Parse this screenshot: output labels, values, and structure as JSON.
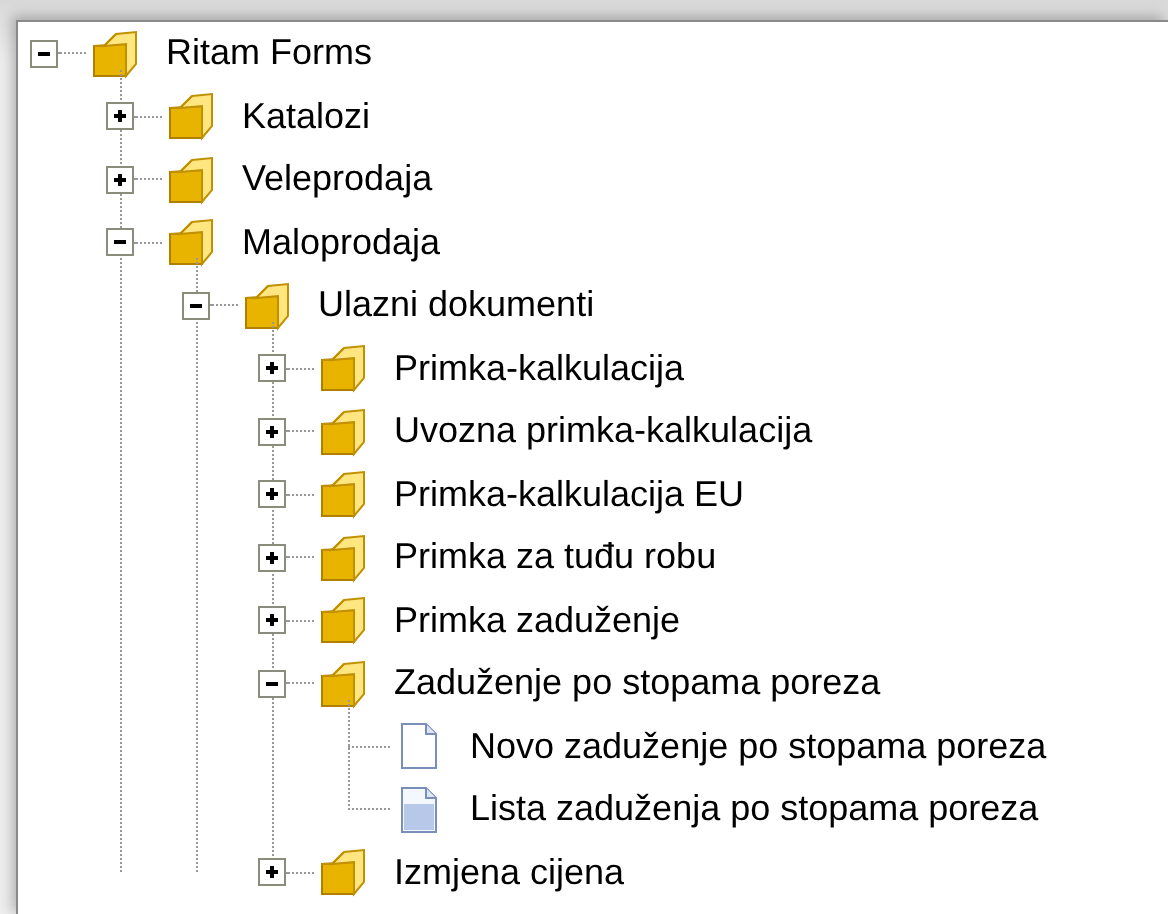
{
  "tree": [
    {
      "label": "Ritam Forms",
      "kind": "folder",
      "expanded": true,
      "children": [
        {
          "label": "Katalozi",
          "kind": "folder",
          "expanded": false
        },
        {
          "label": "Veleprodaja",
          "kind": "folder",
          "expanded": false
        },
        {
          "label": "Maloprodaja",
          "kind": "folder",
          "expanded": true,
          "children": [
            {
              "label": "Ulazni dokumenti",
              "kind": "folder",
              "expanded": true,
              "children": [
                {
                  "label": "Primka-kalkulacija",
                  "kind": "folder",
                  "expanded": false
                },
                {
                  "label": "Uvozna primka-kalkulacija",
                  "kind": "folder",
                  "expanded": false
                },
                {
                  "label": "Primka-kalkulacija EU",
                  "kind": "folder",
                  "expanded": false
                },
                {
                  "label": "Primka za tuđu robu",
                  "kind": "folder",
                  "expanded": false
                },
                {
                  "label": "Primka zaduženje",
                  "kind": "folder",
                  "expanded": false
                },
                {
                  "label": "Zaduženje po stopama poreza",
                  "kind": "folder",
                  "expanded": true,
                  "children": [
                    {
                      "label": "Novo zaduženje po stopama poreza",
                      "kind": "document"
                    },
                    {
                      "label": "Lista zaduženja po stopama poreza",
                      "kind": "list-document"
                    }
                  ]
                },
                {
                  "label": "Izmjena cijena",
                  "kind": "folder",
                  "expanded": false
                }
              ]
            }
          ]
        }
      ]
    }
  ]
}
